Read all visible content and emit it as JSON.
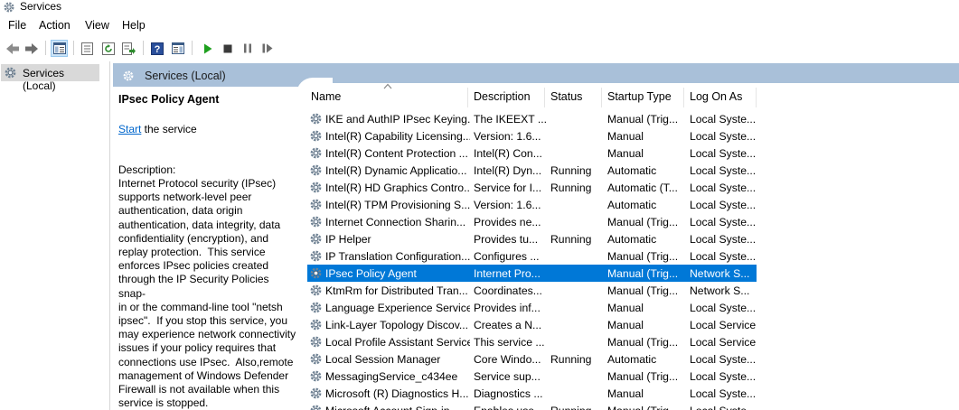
{
  "window": {
    "title": "Services"
  },
  "menu": [
    "File",
    "Action",
    "View",
    "Help"
  ],
  "tree": {
    "selected": "Services (Local)"
  },
  "panel": {
    "header": "Services (Local)"
  },
  "description": {
    "service_name": "IPsec Policy Agent",
    "action_link": "Start",
    "action_rest": " the service",
    "label": "Description:",
    "text": "Internet Protocol security (IPsec)\nsupports network-level peer\nauthentication, data origin\nauthentication, data integrity, data\nconfidentiality (encryption), and\nreplay protection.  This service\nenforces IPsec policies created\nthrough the IP Security Policies snap-\nin or the command-line tool \"netsh\nipsec\".  If you stop this service, you\nmay experience network connectivity\nissues if your policy requires that\nconnections use IPsec.  Also,remote\nmanagement of Windows Defender\nFirewall is not available when this\nservice is stopped."
  },
  "columns": [
    "Name",
    "Description",
    "Status",
    "Startup Type",
    "Log On As"
  ],
  "services": [
    {
      "name": "IKE and AuthIP IPsec Keying...",
      "description": "The IKEEXT ...",
      "status": "",
      "startup": "Manual (Trig...",
      "logon": "Local Syste..."
    },
    {
      "name": "Intel(R) Capability Licensing...",
      "description": "Version: 1.6...",
      "status": "",
      "startup": "Manual",
      "logon": "Local Syste..."
    },
    {
      "name": "Intel(R) Content Protection ...",
      "description": "Intel(R) Con...",
      "status": "",
      "startup": "Manual",
      "logon": "Local Syste..."
    },
    {
      "name": "Intel(R) Dynamic Applicatio...",
      "description": "Intel(R) Dyn...",
      "status": "Running",
      "startup": "Automatic",
      "logon": "Local Syste..."
    },
    {
      "name": "Intel(R) HD Graphics Contro...",
      "description": "Service for I...",
      "status": "Running",
      "startup": "Automatic (T...",
      "logon": "Local Syste..."
    },
    {
      "name": "Intel(R) TPM Provisioning S...",
      "description": "Version: 1.6...",
      "status": "",
      "startup": "Automatic",
      "logon": "Local Syste..."
    },
    {
      "name": "Internet Connection Sharin...",
      "description": "Provides ne...",
      "status": "",
      "startup": "Manual (Trig...",
      "logon": "Local Syste..."
    },
    {
      "name": "IP Helper",
      "description": "Provides tu...",
      "status": "Running",
      "startup": "Automatic",
      "logon": "Local Syste..."
    },
    {
      "name": "IP Translation Configuration...",
      "description": "Configures ...",
      "status": "",
      "startup": "Manual (Trig...",
      "logon": "Local Syste..."
    },
    {
      "name": "IPsec Policy Agent",
      "description": "Internet Pro...",
      "status": "",
      "startup": "Manual (Trig...",
      "logon": "Network S...",
      "selected": true
    },
    {
      "name": "KtmRm for Distributed Tran...",
      "description": "Coordinates...",
      "status": "",
      "startup": "Manual (Trig...",
      "logon": "Network S..."
    },
    {
      "name": "Language Experience Service",
      "description": "Provides inf...",
      "status": "",
      "startup": "Manual",
      "logon": "Local Syste..."
    },
    {
      "name": "Link-Layer Topology Discov...",
      "description": "Creates a N...",
      "status": "",
      "startup": "Manual",
      "logon": "Local Service"
    },
    {
      "name": "Local Profile Assistant Service",
      "description": "This service ...",
      "status": "",
      "startup": "Manual (Trig...",
      "logon": "Local Service"
    },
    {
      "name": "Local Session Manager",
      "description": "Core Windo...",
      "status": "Running",
      "startup": "Automatic",
      "logon": "Local Syste..."
    },
    {
      "name": "MessagingService_c434ee",
      "description": "Service sup...",
      "status": "",
      "startup": "Manual (Trig...",
      "logon": "Local Syste..."
    },
    {
      "name": "Microsoft (R) Diagnostics H...",
      "description": "Diagnostics ...",
      "status": "",
      "startup": "Manual",
      "logon": "Local Syste..."
    },
    {
      "name": "Microsoft Account Sign-in ...",
      "description": "Enables use...",
      "status": "Running",
      "startup": "Manual (Trig...",
      "logon": "Local Syste..."
    }
  ],
  "colors": {
    "selection": "#0078d7",
    "header_band": "#a9c0d9",
    "link": "#0066cc"
  }
}
